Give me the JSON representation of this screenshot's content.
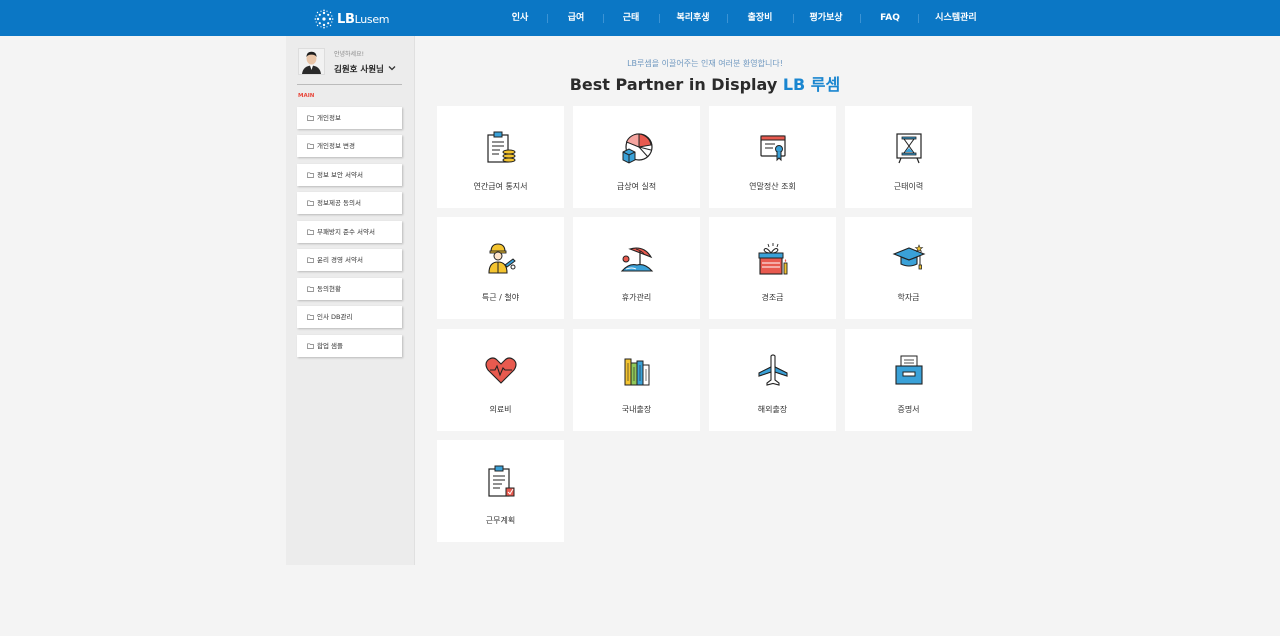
{
  "header": {
    "logo": {
      "bold": "LB",
      "light": "Lusem"
    },
    "nav": [
      "인사",
      "급여",
      "근태",
      "복리후생",
      "출장비",
      "평가보상",
      "FAQ",
      "시스템관리"
    ]
  },
  "sidebar": {
    "greeting": "안녕하세요!",
    "user_name": "김원호 사원님",
    "section_label": "MAIN",
    "items": [
      "개인정보",
      "개인정보 변경",
      "정보 보안 서약서",
      "정보제공 동의서",
      "부패방지 준수 서약서",
      "윤리 경영 서약서",
      "동의현황",
      "인사 DB관리",
      "합업 샘플"
    ]
  },
  "hero": {
    "subtitle": "LB루셈을 이끌어주는 인재 여러분 환영합니다!",
    "title_main": "Best Partner in Display ",
    "title_highlight": "LB 루셈"
  },
  "cards": [
    {
      "label": "연간급여 통지서",
      "icon": "clipboard-coins-icon"
    },
    {
      "label": "급상여 실적",
      "icon": "pie-chart-icon"
    },
    {
      "label": "연말정산 조회",
      "icon": "certificate-icon"
    },
    {
      "label": "근태이력",
      "icon": "hourglass-icon"
    },
    {
      "label": "특근 / 철야",
      "icon": "worker-icon"
    },
    {
      "label": "휴가관리",
      "icon": "beach-umbrella-icon"
    },
    {
      "label": "경조금",
      "icon": "gift-box-icon"
    },
    {
      "label": "학자금",
      "icon": "graduation-cap-icon"
    },
    {
      "label": "의료비",
      "icon": "heart-pulse-icon"
    },
    {
      "label": "국내출장",
      "icon": "buildings-icon"
    },
    {
      "label": "해외출장",
      "icon": "airplane-icon"
    },
    {
      "label": "증명서",
      "icon": "document-tray-icon"
    },
    {
      "label": "근무계획",
      "icon": "clipboard-plan-icon"
    }
  ],
  "colors": {
    "header": "#0b77c5",
    "accent": "#1a86d0",
    "main_label": "#e8473b"
  }
}
